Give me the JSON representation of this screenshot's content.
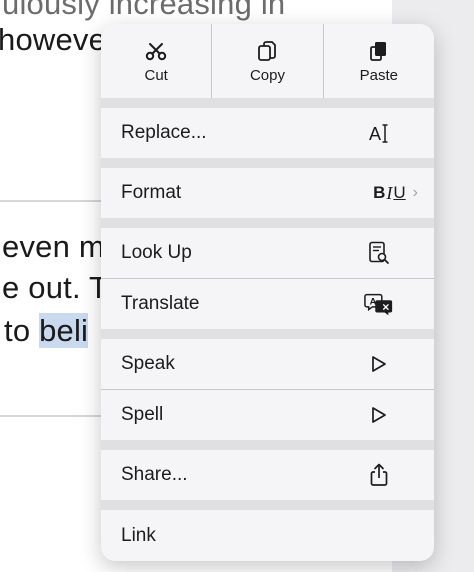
{
  "document": {
    "line1": "ulously increasing in",
    "line2": "howeve",
    "line3": "even m",
    "line4": "e out. T",
    "line5_before": "to ",
    "line5_selected": "beli"
  },
  "menu": {
    "top": [
      {
        "label": "Cut",
        "icon": "scissors-icon"
      },
      {
        "label": "Copy",
        "icon": "copy-icon"
      },
      {
        "label": "Paste",
        "icon": "paste-icon"
      }
    ],
    "items": {
      "replace": "Replace...",
      "format": "Format",
      "format_b": "B",
      "format_i": "I",
      "format_u": "U",
      "lookup": "Look Up",
      "translate": "Translate",
      "speak": "Speak",
      "spell": "Spell",
      "share": "Share...",
      "link": "Link"
    }
  }
}
